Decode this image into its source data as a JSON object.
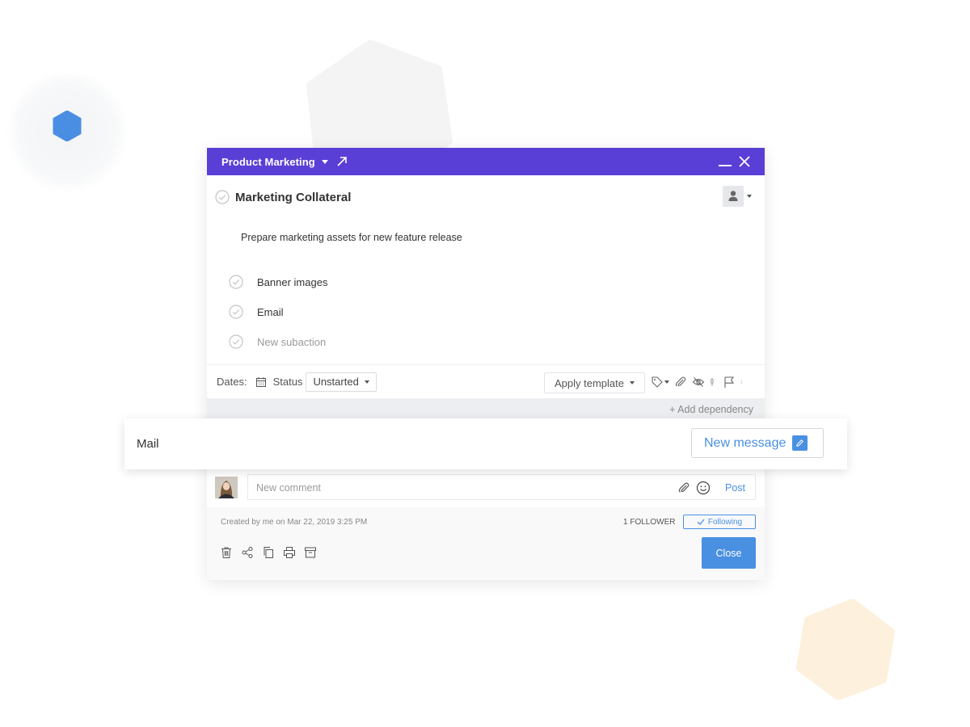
{
  "colors": {
    "header_purple": "#5a3fd6",
    "accent_blue": "#4a90e2",
    "deco_blue_hex": "#4a8ee3",
    "deco_peach_hex": "#fdf0dc",
    "deco_gray_hex": "#f4f4f5"
  },
  "window": {
    "project_name": "Product Marketing",
    "title_icons": [
      "chevron-down-icon",
      "expand-arrow-icon",
      "minimize-icon",
      "close-icon"
    ],
    "task_title": "Marketing Collateral",
    "description": "Prepare marketing assets for new feature release",
    "subactions": [
      {
        "label": "Banner images",
        "placeholder": false
      },
      {
        "label": "Email",
        "placeholder": false
      },
      {
        "label": "New subaction",
        "placeholder": true
      }
    ],
    "toolbar": {
      "dates_label": "Dates:",
      "status_label": "Status",
      "status_value": "Unstarted",
      "template_label": "Apply template",
      "icons": [
        "tag-icon",
        "paperclip-icon",
        "eye-off-icon",
        "priority-icon",
        "flag-icon",
        "more-vertical-icon"
      ]
    },
    "add_dependency": "+ Add dependency",
    "comment": {
      "placeholder": "New comment",
      "post_label": "Post"
    },
    "footer": {
      "created": "Created by me on Mar 22, 2019 3:25 PM",
      "followers": "1 FOLLOWER",
      "following": "Following",
      "icons": [
        "trash-icon",
        "share-icon",
        "duplicate-icon",
        "print-icon",
        "archive-icon"
      ],
      "close_label": "Close"
    }
  },
  "mail": {
    "label": "Mail",
    "new_message_label": "New message"
  }
}
